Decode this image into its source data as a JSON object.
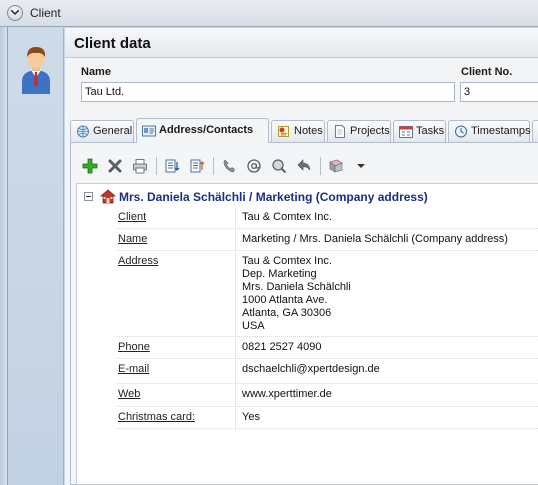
{
  "window": {
    "title": "Client"
  },
  "header": {
    "title": "Client data"
  },
  "form": {
    "name_label": "Name",
    "name_value": "Tau Ltd.",
    "client_no_label": "Client No.",
    "client_no_value": "3"
  },
  "tabs": [
    {
      "label": "General",
      "icon": "globe-icon",
      "active": false
    },
    {
      "label": "Address/Contacts",
      "icon": "address-card-icon",
      "active": true
    },
    {
      "label": "Notes",
      "icon": "notes-icon",
      "active": false
    },
    {
      "label": "Projects",
      "icon": "document-icon",
      "active": false
    },
    {
      "label": "Tasks",
      "icon": "calendar-tasks-icon",
      "active": false
    },
    {
      "label": "Timestamps",
      "icon": "clock-icon",
      "active": false
    }
  ],
  "toolbar": {
    "icons": [
      "add-icon",
      "delete-icon",
      "print-icon",
      "import-icon",
      "export-icon",
      "phone-icon",
      "email-icon",
      "search-web-icon",
      "back-arrow-icon",
      "book-icon",
      "dropdown-arrow-icon"
    ]
  },
  "contact": {
    "group_title": "Mrs. Daniela Schälchli / Marketing (Company address)",
    "fields": [
      {
        "label": "Client",
        "value_lines": [
          "Tau & Comtex Inc."
        ]
      },
      {
        "label": "Name",
        "value_lines": [
          "Marketing / Mrs. Daniela Schälchli (Company address)"
        ]
      },
      {
        "label": "Address",
        "value_lines": [
          "Tau & Comtex Inc.",
          "Dep. Marketing",
          "Mrs. Daniela Schälchli",
          "1000 Atlanta Ave.",
          "Atlanta, GA 30306",
          "USA"
        ]
      },
      {
        "label": "Phone",
        "value_lines": [
          "0821 2527 4090"
        ]
      },
      {
        "label": "E-mail",
        "value_lines": [
          "dschaelchli@xpertdesign.de"
        ]
      },
      {
        "label": "Web",
        "value_lines": [
          "www.xperttimer.de"
        ]
      },
      {
        "label": "Christmas card:",
        "value_lines": [
          "Yes"
        ]
      }
    ]
  },
  "colors": {
    "accent_title": "#1a2e86",
    "add_green": "#2f9a1e",
    "house_red": "#c8322a"
  }
}
